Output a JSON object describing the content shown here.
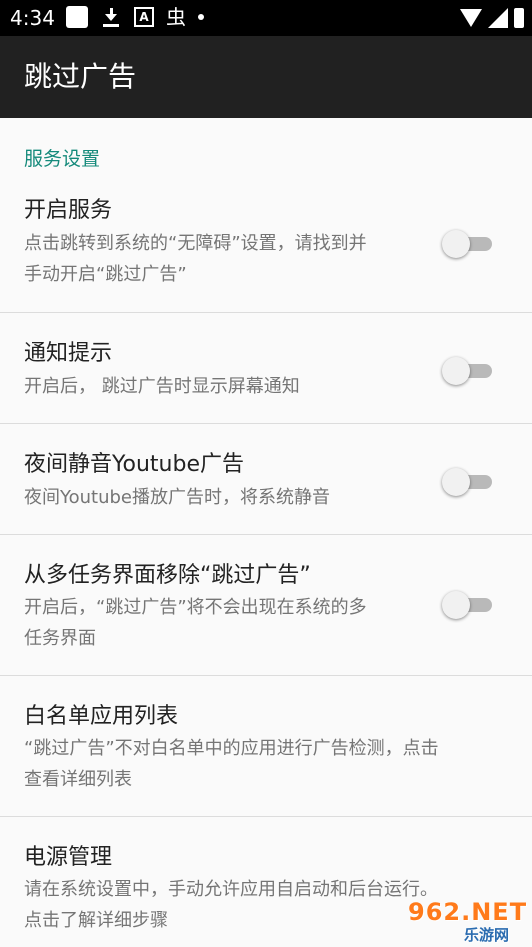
{
  "status_bar": {
    "time": "4:34",
    "icons": [
      "app-square-icon",
      "download-icon",
      "a-box-icon",
      "bug-icon",
      "dot-icon",
      "wifi-icon",
      "signal-icon",
      "battery-icon"
    ],
    "bug_glyph": "虫"
  },
  "app_bar": {
    "title": "跳过广告"
  },
  "section": {
    "title": "服务设置"
  },
  "items": [
    {
      "title": "开启服务",
      "desc_lines": [
        "点击跳转到系统的“无障碍”设置，请找到并",
        "手动开启“跳过广告”"
      ],
      "toggle": false
    },
    {
      "title": "通知提示",
      "desc_lines": [
        "开启后， 跳过广告时显示屏幕通知"
      ],
      "toggle": false
    },
    {
      "title": "夜间静音Youtube广告",
      "desc_lines": [
        "夜间Youtube播放广告时，将系统静音"
      ],
      "toggle": false
    },
    {
      "title": "从多任务界面移除“跳过广告”",
      "desc_lines": [
        "开启后，“跳过广告”将不会出现在系统的多",
        "任务界面"
      ],
      "toggle": false
    },
    {
      "title": "白名单应用列表",
      "desc_lines": [
        "“跳过广告”不对白名单中的应用进行广告检测，点击",
        "查看详细列表"
      ]
    },
    {
      "title": "电源管理",
      "desc_lines": [
        "请在系统设置中，手动允许应用自启动和后台运行。",
        "点击了解详细步骤"
      ]
    }
  ],
  "watermark": {
    "text": "962.NET",
    "sub": "乐游网"
  },
  "colors": {
    "accent": "#158a7b",
    "app_bar": "#212121",
    "status_bar": "#000000",
    "background": "#fafafa"
  }
}
